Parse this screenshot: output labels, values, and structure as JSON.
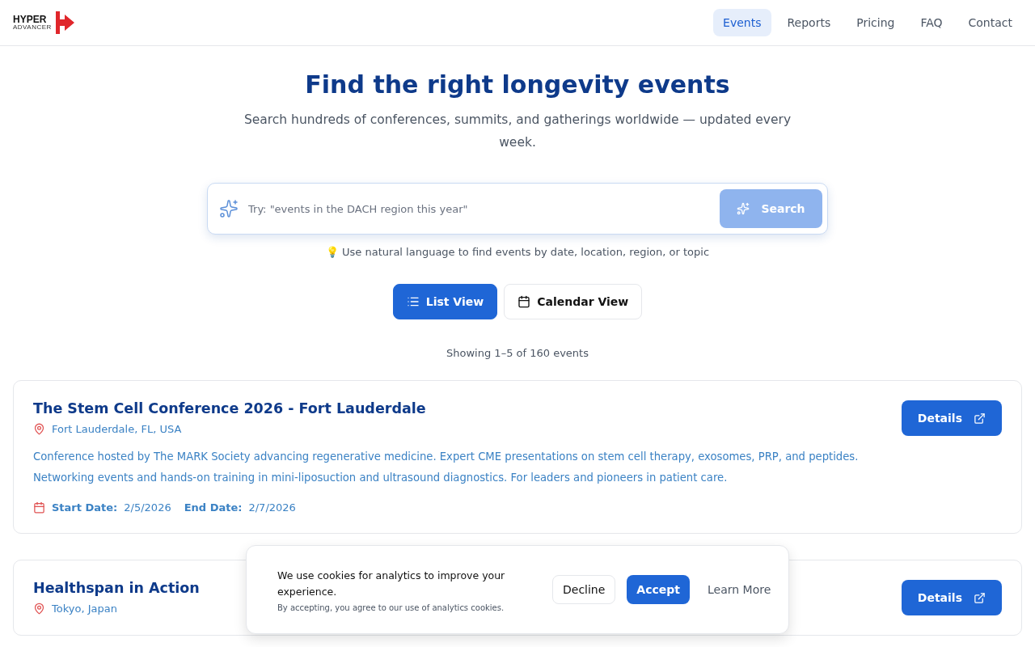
{
  "header": {
    "logo": {
      "top": "HYPER",
      "bottom": "ADVANCER"
    },
    "nav": [
      {
        "label": "Events",
        "selected": true
      },
      {
        "label": "Reports",
        "selected": false
      },
      {
        "label": "Pricing",
        "selected": false
      },
      {
        "label": "FAQ",
        "selected": false
      },
      {
        "label": "Contact",
        "selected": false
      }
    ]
  },
  "hero": {
    "title": "Find the right longevity events",
    "subtitle": "Search hundreds of conferences, summits, and gatherings worldwide — updated every week."
  },
  "search": {
    "placeholder": "Try: \"events in the DACH region this year\"",
    "button": "Search",
    "disabled": true,
    "hint_emoji": "💡",
    "hint": "Use natural language to find events by date, location, region, or topic"
  },
  "views": [
    {
      "label": "List View",
      "kind": "list",
      "selected": true
    },
    {
      "label": "Calendar View",
      "kind": "calendar",
      "selected": false
    }
  ],
  "results_count": "Showing 1–5 of 160 events",
  "events": [
    {
      "title": "The Stem Cell Conference 2026 - Fort Lauderdale",
      "location": "Fort Lauderdale, FL, USA",
      "description": "Conference hosted by The MARK Society advancing regenerative medicine. Expert CME presentations on stem cell therapy, exosomes, PRP, and peptides. Networking events and hands-on training in mini-liposuction and ultrasound diagnostics. For leaders and pioneers in patient care.",
      "start_label": "Start Date:",
      "start": "2/5/2026",
      "end_label": "End Date:",
      "end": "2/7/2026",
      "button": "Details"
    },
    {
      "title": "Healthspan in Action",
      "location": "Tokyo, Japan",
      "button": "Details"
    }
  ],
  "cookie": {
    "message": "We use cookies for analytics to improve your experience.",
    "note": "By accepting, you agree to our use of analytics cookies.",
    "decline": "Decline",
    "accept": "Accept",
    "learn_more": "Learn More"
  }
}
